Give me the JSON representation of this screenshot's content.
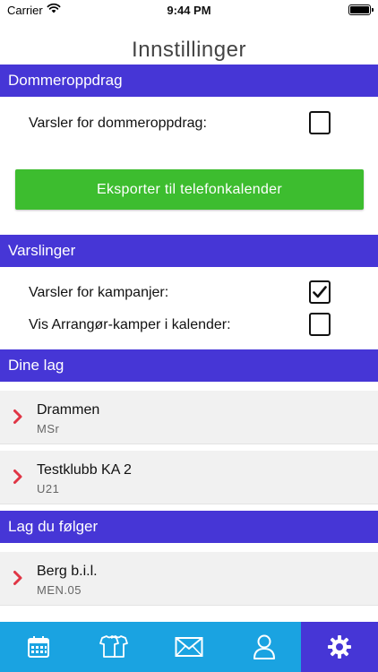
{
  "status_bar": {
    "carrier": "Carrier",
    "time": "9:44 PM"
  },
  "page": {
    "title": "Innstillinger"
  },
  "sections": {
    "referee": {
      "title": "Dommeroppdrag",
      "notify_label": "Varsler for dommeroppdrag:",
      "notify_checked": false,
      "export_button": "Eksporter til telefonkalender"
    },
    "notifications": {
      "title": "Varslinger",
      "campaigns_label": "Varsler for kampanjer:",
      "campaigns_checked": true,
      "organizer_label": "Vis Arrangør-kamper i kalender:",
      "organizer_checked": false
    },
    "my_teams": {
      "title": "Dine lag",
      "items": [
        {
          "name": "Drammen",
          "sub": "MSr"
        },
        {
          "name": "Testklubb KA 2",
          "sub": "U21"
        }
      ]
    },
    "followed_teams": {
      "title": "Lag du følger",
      "items": [
        {
          "name": "Berg b.i.l.",
          "sub": "MEN.05"
        }
      ]
    }
  },
  "tab_bar": {
    "tabs": [
      {
        "icon": "calendar-icon",
        "active": false
      },
      {
        "icon": "jerseys-icon",
        "active": false
      },
      {
        "icon": "envelope-icon",
        "active": false
      },
      {
        "icon": "person-icon",
        "active": false
      },
      {
        "icon": "gear-icon",
        "active": true
      }
    ]
  },
  "colors": {
    "header": "#4636d6",
    "button": "#3dbd2f",
    "tabbar": "#1aa3e1",
    "tab_active": "#4636d6",
    "chevron": "#e03545"
  }
}
